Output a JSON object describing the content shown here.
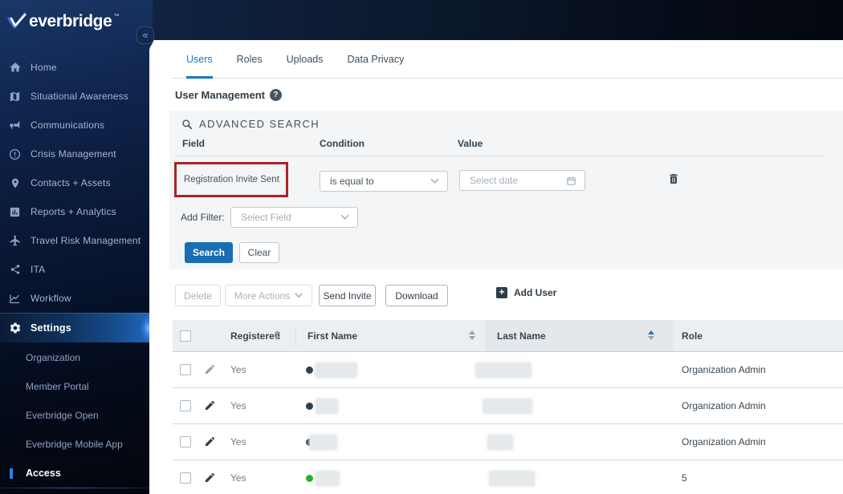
{
  "brand": {
    "logo_text": "everbridge",
    "trademark": "™",
    "collapse_icon": "«"
  },
  "sidebar": {
    "items": [
      {
        "label": "Home"
      },
      {
        "label": "Situational Awareness"
      },
      {
        "label": "Communications"
      },
      {
        "label": "Crisis Management"
      },
      {
        "label": "Contacts + Assets"
      },
      {
        "label": "Reports + Analytics"
      },
      {
        "label": "Travel Risk Management"
      },
      {
        "label": "ITA"
      },
      {
        "label": "Workflow"
      },
      {
        "label": "Settings",
        "active": true
      }
    ],
    "settings_subitems": [
      {
        "label": "Organization"
      },
      {
        "label": "Member Portal"
      },
      {
        "label": "Everbridge Open"
      },
      {
        "label": "Everbridge Mobile App"
      },
      {
        "label": "Access",
        "active": true
      }
    ]
  },
  "tabs": [
    {
      "label": "Users",
      "active": true
    },
    {
      "label": "Roles"
    },
    {
      "label": "Uploads"
    },
    {
      "label": "Data Privacy"
    }
  ],
  "page": {
    "title": "User Management",
    "help_glyph": "?"
  },
  "advanced_search": {
    "title": "ADVANCED SEARCH",
    "columns": {
      "field": "Field",
      "condition": "Condition",
      "value": "Value"
    },
    "filter_row": {
      "field": "Registration Invite Sent",
      "condition": "is equal to",
      "value_placeholder": "Select date"
    },
    "add_filter_label": "Add Filter:",
    "add_filter_placeholder": "Select Field",
    "search_label": "Search",
    "clear_label": "Clear"
  },
  "actions": {
    "delete": "Delete",
    "more_actions": "More Actions",
    "send_invite": "Send Invite",
    "download": "Download",
    "add_user": "Add User",
    "plus_glyph": "+"
  },
  "table": {
    "headers": {
      "registered": "Registered",
      "first_name": "First Name",
      "last_name": "Last Name",
      "role": "Role"
    },
    "sort_state": {
      "last_name": "ascending"
    },
    "rows": [
      {
        "registered": "Yes",
        "first_name_redacted": true,
        "last_name_redacted": true,
        "role": "Organization Admin",
        "status_dot_color": "#2e4154"
      },
      {
        "registered": "Yes",
        "first_name_redacted": true,
        "last_name_redacted": true,
        "role": "Organization Admin",
        "status_dot_color": "#2e4154"
      },
      {
        "registered": "Yes",
        "first_name_redacted": true,
        "last_name_redacted": true,
        "role": "Organization Admin",
        "status_dot_color": "#2e4154"
      },
      {
        "registered": "Yes",
        "first_name_redacted": true,
        "last_name_redacted": true,
        "role": "5",
        "status_dot_color": "#2bb229"
      }
    ]
  },
  "colors": {
    "accent_blue": "#1878be",
    "search_button_blue": "#1a6db3",
    "annotation_red": "#a92428",
    "status_dot_navy": "#2e4154",
    "status_dot_green": "#2bb229",
    "settings_glow_blue": "#2f7fe0",
    "sidebar_navy": "#0a1a38"
  }
}
